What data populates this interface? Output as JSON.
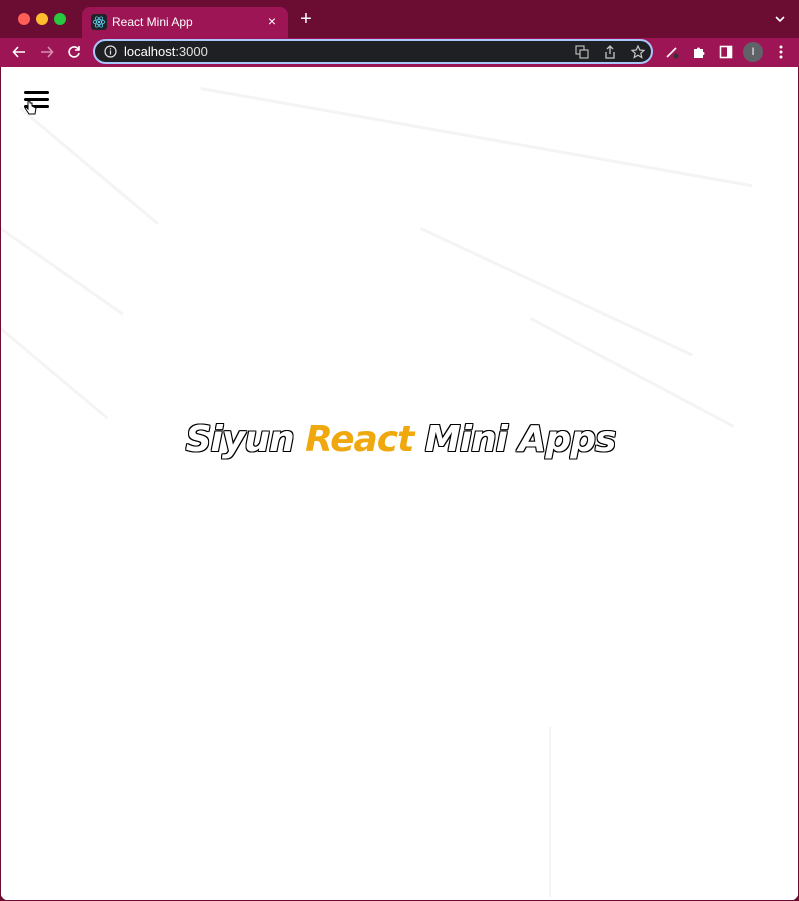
{
  "browser": {
    "tab": {
      "title": "React Mini App",
      "close_glyph": "×",
      "favicon": "react-icon"
    },
    "new_tab_glyph": "+",
    "omnibox": {
      "host": "localhost",
      "port": ":3000"
    },
    "profile_initial": "I"
  },
  "page": {
    "menu_icon": "hamburger-icon",
    "heading": {
      "part1": "Siyun",
      "accent": "React",
      "part2": "Mini Apps"
    }
  },
  "colors": {
    "browser_frame": "#6b0d33",
    "tab_active": "#9e1555",
    "accent": "#f0a80f",
    "omnibox_border": "#a8c7fa"
  }
}
